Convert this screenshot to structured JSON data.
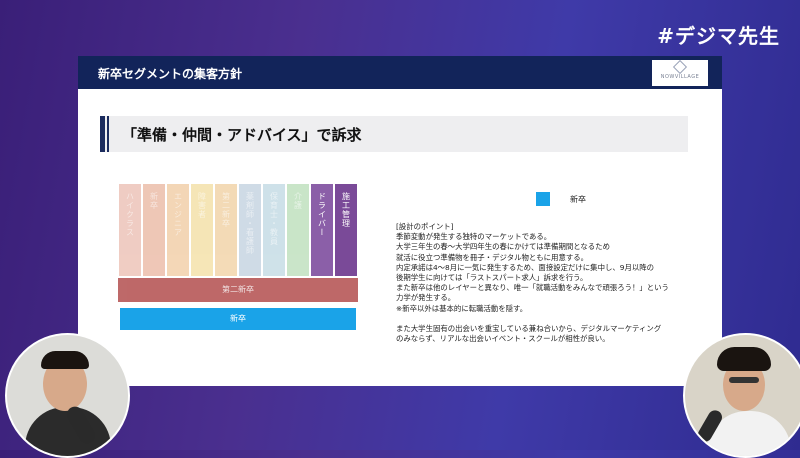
{
  "brand": "#デジマ先生",
  "slide": {
    "header_title": "新卒セグメントの集客方針",
    "logo_text": "NOWVILLAGE",
    "headline": "「準備・仲間・アドバイス」で訴求",
    "diagram": {
      "columns": [
        {
          "label": "ハイクラス",
          "color": "#d9826a",
          "emphasis": "dim"
        },
        {
          "label": "新卒",
          "color": "#d7744a",
          "emphasis": "dim"
        },
        {
          "label": "エンジニア",
          "color": "#e39a4a",
          "emphasis": "dim"
        },
        {
          "label": "障害者",
          "color": "#e8c04a",
          "emphasis": "dim"
        },
        {
          "label": "第二新卒",
          "color": "#e3a44a",
          "emphasis": "dim"
        },
        {
          "label": "薬剤師・看護師",
          "color": "#8aa7c2",
          "emphasis": "dim"
        },
        {
          "label": "保育士・教員",
          "color": "#87b6c9",
          "emphasis": "dim"
        },
        {
          "label": "介護",
          "color": "#7bbf78",
          "emphasis": "dim"
        },
        {
          "label": "ドライバー",
          "color": "#8b5fa8",
          "emphasis": "bright"
        },
        {
          "label": "施工管理",
          "color": "#7a4a98",
          "emphasis": "bright"
        }
      ],
      "second_grad_band": "第二新卒",
      "new_grad_band": "新卒"
    },
    "legend": {
      "label": "新卒",
      "color": "#1aa3e8"
    },
    "notes": [
      "[設計のポイント]",
      "季節変動が発生する独特のマーケットである。",
      "大学三年生の春〜大学四年生の春にかけては準備期間となるため",
      "就活に役立つ準備物を冊子・デジタル物ともに用意する。",
      "内定承諾は4〜8月に一気に発生するため、面接設定だけに集中し、9月以降の",
      "後期学生に向けては「ラストスパート求人」訴求を行う。",
      "また新卒は他のレイヤーと異なり、唯一「就職活動をみんなで頑張ろう！」という",
      "力学が発生する。",
      "※新卒以外は基本的に転職活動を隠す。",
      "",
      "また大学生固有の出会いを重宝している兼ね合いから、デジタルマーケティング",
      "のみならず、リアルな出会いイベント・スクールが相性が良い。"
    ]
  },
  "colors": {
    "header_navy": "#12245a",
    "second_grad_red": "#b04848",
    "new_grad_blue": "#1aa3e8"
  }
}
